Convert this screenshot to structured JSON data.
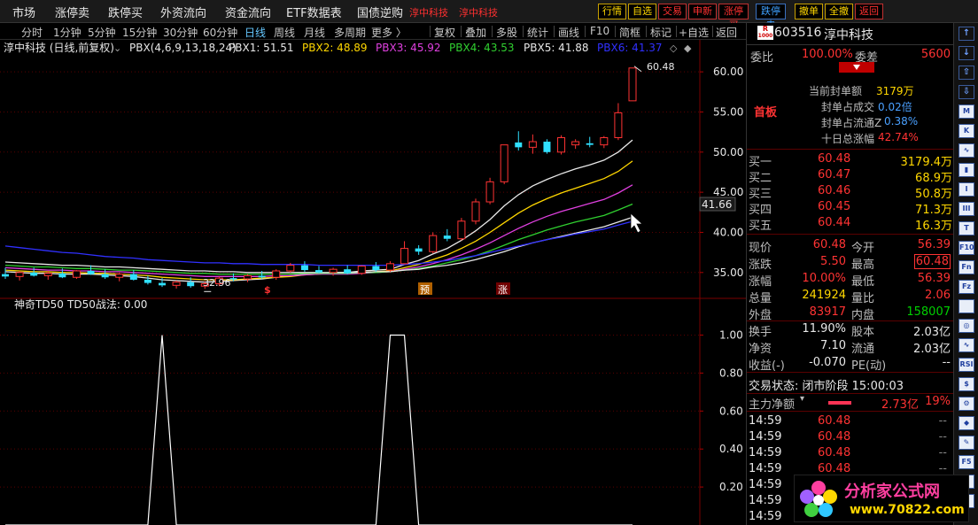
{
  "menu": {
    "items": [
      "市场",
      "涨停卖",
      "跌停买",
      "外资流向",
      "资金流向",
      "ETF数据表",
      "国债逆购"
    ],
    "red_items": [
      "淳中科技",
      "淳中科技"
    ],
    "buttons": [
      "行情",
      "自选",
      "交易",
      "申新",
      "涨停买",
      "跌停卖",
      "撤单",
      "全撤",
      "返回"
    ]
  },
  "toolbar": {
    "left": [
      "分时",
      "1分钟",
      "5分钟",
      "15分钟",
      "30分钟",
      "60分钟",
      "日线",
      "周线",
      "月线",
      "多周期",
      "更多 〉"
    ],
    "active": "日线",
    "right": [
      "复权",
      "叠加",
      "多股",
      "统计",
      "画线",
      "F10",
      "简框",
      "标记",
      "+自选",
      "返回"
    ]
  },
  "legend": {
    "title": "淳中科技 (日线,前复权)",
    "formula": "PBX(4,6,9,13,18,24)",
    "items": [
      {
        "label": "PBX1: 51.51",
        "color": "#e8e8e8"
      },
      {
        "label": "PBX2: 48.89",
        "color": "#ffd700"
      },
      {
        "label": "PBX3: 45.92",
        "color": "#e040e0"
      },
      {
        "label": "PBX4: 43.53",
        "color": "#30d030"
      },
      {
        "label": "PBX5: 41.88",
        "color": "#e8e8e8"
      },
      {
        "label": "PBX6: 41.37",
        "color": "#3030ff"
      }
    ]
  },
  "price_axis": {
    "ticks": [
      "60.00",
      "55.00",
      "50.00",
      "45.00",
      "40.00",
      "35.00"
    ],
    "current": "41.66"
  },
  "annotations": {
    "high": "60.48",
    "low": "32.96",
    "signals": [
      "$",
      "预",
      "涨"
    ]
  },
  "indicator": {
    "name": "神奇TD50",
    "value_label": "TD50战法: 0.00",
    "ticks": [
      "1.00",
      "0.80",
      "0.60",
      "0.40",
      "0.20"
    ]
  },
  "stock": {
    "code": "603516",
    "name": "淳中科技",
    "badge_top": "R",
    "badge_bottom": "1000"
  },
  "quote": {
    "weibi_label": "委比",
    "weibi": "100.00%",
    "weicha_label": "委差",
    "weicha": "5600",
    "tag": "首板",
    "seal": [
      {
        "label": "当前封单额",
        "value": "3179万",
        "color": "#ffd700"
      },
      {
        "label": "封单占成交",
        "value": "0.02倍",
        "color": "#4aa0ff"
      },
      {
        "label": "封单占流通Z",
        "value": "0.38%",
        "color": "#4aa0ff"
      },
      {
        "label": "十日总涨幅",
        "value": "42.74%",
        "color": "#ff3333"
      }
    ],
    "bids": [
      {
        "label": "买一",
        "price": "60.48",
        "vol": "3179.4万"
      },
      {
        "label": "买二",
        "price": "60.47",
        "vol": "68.9万"
      },
      {
        "label": "买三",
        "price": "60.46",
        "vol": "50.8万"
      },
      {
        "label": "买四",
        "price": "60.45",
        "vol": "71.3万"
      },
      {
        "label": "买五",
        "price": "60.44",
        "vol": "16.3万"
      }
    ],
    "stats": [
      {
        "l1": "现价",
        "v1": "60.48",
        "c1": "#ff3333",
        "l2": "今开",
        "v2": "56.39",
        "c2": "#ff3333"
      },
      {
        "l1": "涨跌",
        "v1": "5.50",
        "c1": "#ff3333",
        "l2": "最高",
        "v2": "60.48",
        "c2": "#ff3333"
      },
      {
        "l1": "涨幅",
        "v1": "10.00%",
        "c1": "#ff3333",
        "l2": "最低",
        "v2": "56.39",
        "c2": "#ff3333"
      },
      {
        "l1": "总量",
        "v1": "241924",
        "c1": "#ffd700",
        "l2": "量比",
        "v2": "2.06",
        "c2": "#ff3333"
      },
      {
        "l1": "外盘",
        "v1": "83917",
        "c1": "#ff3333",
        "l2": "内盘",
        "v2": "158007",
        "c2": "#00d000"
      },
      {
        "l1": "换手",
        "v1": "11.90%",
        "c1": "#e8e8e8",
        "l2": "股本",
        "v2": "2.03亿",
        "c2": "#e8e8e8"
      },
      {
        "l1": "净资",
        "v1": "7.10",
        "c1": "#e8e8e8",
        "l2": "流通",
        "v2": "2.03亿",
        "c2": "#e8e8e8"
      },
      {
        "l1": "收益(-)",
        "v1": "-0.070",
        "c1": "#e8e8e8",
        "l2": "PE(动)",
        "v2": "--",
        "c2": "#e8e8e8"
      }
    ],
    "trade_status": "交易状态: 闭市阶段 15:00:03",
    "main_flow_label": "主力净额",
    "main_flow_value": "2.73亿",
    "main_flow_pct": "19%",
    "ticks": [
      {
        "time": "14:59",
        "price": "60.48",
        "vol": "--"
      },
      {
        "time": "14:59",
        "price": "60.48",
        "vol": "--"
      },
      {
        "time": "14:59",
        "price": "60.48",
        "vol": "--"
      },
      {
        "time": "14:59",
        "price": "60.48",
        "vol": "--"
      },
      {
        "time": "14:59",
        "price": "60.48",
        "vol": "--"
      },
      {
        "time": "14:59",
        "price": "",
        "vol": ""
      },
      {
        "time": "14:59",
        "price": "",
        "vol": ""
      },
      {
        "time": "14:59",
        "price": "",
        "vol": ""
      }
    ]
  },
  "iconbar": [
    "↑",
    "↓",
    "⇧",
    "⇩",
    "M",
    "K",
    "∿",
    "▮",
    "I",
    "III",
    "T",
    "F10",
    "Fn",
    "Fz",
    "",
    "◎",
    "∿",
    "RSI",
    "$",
    "⚙",
    "⬥",
    "✎",
    "F5",
    "⇆",
    ""
  ],
  "watermark": {
    "brand": "分析家公式网",
    "url": "www.70822.com"
  },
  "colors": {
    "up": "#ff3333",
    "down": "#30e0ff",
    "bg": "#000000",
    "grid": "#5a0000",
    "pbx1": "#e8e8e8",
    "pbx2": "#ffd700",
    "pbx3": "#e040e0",
    "pbx4": "#30d030",
    "pbx5": "#e8e8e8",
    "pbx6": "#3030ff"
  },
  "chart_data": {
    "type": "candlestick",
    "ylim": [
      32,
      62
    ],
    "indicator_ylim": [
      0,
      1.1
    ],
    "candles": [
      {
        "o": 34.8,
        "h": 35.6,
        "l": 34.2,
        "c": 34.5
      },
      {
        "o": 34.5,
        "h": 35.2,
        "l": 34.0,
        "c": 35.0
      },
      {
        "o": 35.0,
        "h": 35.6,
        "l": 34.5,
        "c": 34.6
      },
      {
        "o": 34.6,
        "h": 35.2,
        "l": 34.1,
        "c": 34.9
      },
      {
        "o": 34.9,
        "h": 35.5,
        "l": 34.3,
        "c": 34.4
      },
      {
        "o": 34.4,
        "h": 35.3,
        "l": 34.2,
        "c": 35.2
      },
      {
        "o": 35.2,
        "h": 35.9,
        "l": 34.7,
        "c": 34.8
      },
      {
        "o": 34.8,
        "h": 35.4,
        "l": 34.2,
        "c": 34.4
      },
      {
        "o": 34.4,
        "h": 35.0,
        "l": 33.9,
        "c": 34.8
      },
      {
        "o": 34.8,
        "h": 35.3,
        "l": 34.0,
        "c": 34.1
      },
      {
        "o": 34.1,
        "h": 34.6,
        "l": 33.5,
        "c": 33.7
      },
      {
        "o": 33.7,
        "h": 34.3,
        "l": 33.2,
        "c": 33.4
      },
      {
        "o": 33.4,
        "h": 34.0,
        "l": 33.0,
        "c": 33.8
      },
      {
        "o": 33.8,
        "h": 34.4,
        "l": 33.1,
        "c": 33.3
      },
      {
        "o": 33.3,
        "h": 33.9,
        "l": 32.96,
        "c": 33.6
      },
      {
        "o": 33.6,
        "h": 34.5,
        "l": 33.3,
        "c": 34.3
      },
      {
        "o": 34.3,
        "h": 34.9,
        "l": 33.9,
        "c": 34.2
      },
      {
        "o": 34.2,
        "h": 34.8,
        "l": 33.8,
        "c": 34.6
      },
      {
        "o": 34.6,
        "h": 35.2,
        "l": 34.2,
        "c": 34.4
      },
      {
        "o": 34.4,
        "h": 35.4,
        "l": 34.1,
        "c": 35.2
      },
      {
        "o": 35.2,
        "h": 36.2,
        "l": 35.0,
        "c": 35.9
      },
      {
        "o": 35.9,
        "h": 36.4,
        "l": 35.1,
        "c": 35.3
      },
      {
        "o": 35.3,
        "h": 35.8,
        "l": 34.9,
        "c": 35.0
      },
      {
        "o": 35.0,
        "h": 35.6,
        "l": 34.6,
        "c": 35.4
      },
      {
        "o": 35.4,
        "h": 35.9,
        "l": 34.8,
        "c": 34.9
      },
      {
        "o": 34.9,
        "h": 35.9,
        "l": 34.7,
        "c": 35.8
      },
      {
        "o": 35.8,
        "h": 36.3,
        "l": 35.1,
        "c": 35.3
      },
      {
        "o": 35.3,
        "h": 36.4,
        "l": 35.1,
        "c": 36.1
      },
      {
        "o": 36.1,
        "h": 38.9,
        "l": 36.0,
        "c": 38.0
      },
      {
        "o": 38.0,
        "h": 38.4,
        "l": 37.2,
        "c": 37.6
      },
      {
        "o": 37.6,
        "h": 40.0,
        "l": 37.4,
        "c": 39.6
      },
      {
        "o": 39.6,
        "h": 40.4,
        "l": 38.9,
        "c": 39.2
      },
      {
        "o": 39.2,
        "h": 41.8,
        "l": 39.0,
        "c": 41.4
      },
      {
        "o": 41.4,
        "h": 44.2,
        "l": 41.0,
        "c": 43.8
      },
      {
        "o": 43.8,
        "h": 46.8,
        "l": 43.5,
        "c": 46.3
      },
      {
        "o": 46.3,
        "h": 50.9,
        "l": 46.0,
        "c": 50.9
      },
      {
        "o": 51.2,
        "h": 52.6,
        "l": 50.2,
        "c": 50.6
      },
      {
        "o": 50.6,
        "h": 52.2,
        "l": 49.8,
        "c": 51.3
      },
      {
        "o": 51.3,
        "h": 51.6,
        "l": 49.8,
        "c": 50.0
      },
      {
        "o": 50.0,
        "h": 52.1,
        "l": 49.7,
        "c": 51.8
      },
      {
        "o": 50.9,
        "h": 51.6,
        "l": 50.4,
        "c": 51.3
      },
      {
        "o": 51.1,
        "h": 51.9,
        "l": 50.6,
        "c": 50.9
      },
      {
        "o": 50.9,
        "h": 52.0,
        "l": 50.5,
        "c": 51.8
      },
      {
        "o": 51.8,
        "h": 56.1,
        "l": 51.5,
        "c": 54.9
      },
      {
        "o": 56.39,
        "h": 60.48,
        "l": 56.39,
        "c": 60.48
      }
    ],
    "series": [
      {
        "name": "PBX1",
        "color": "#e8e8e8",
        "y": [
          35.1,
          35.0,
          34.9,
          34.9,
          34.8,
          34.8,
          34.8,
          34.7,
          34.6,
          34.5,
          34.3,
          34.1,
          34.0,
          33.9,
          33.8,
          33.9,
          34.0,
          34.1,
          34.2,
          34.4,
          34.6,
          34.8,
          34.9,
          35.0,
          35.0,
          35.2,
          35.3,
          35.4,
          36.0,
          36.5,
          37.3,
          38.0,
          39.0,
          40.2,
          41.6,
          43.3,
          44.7,
          45.8,
          46.6,
          47.3,
          47.9,
          48.4,
          49.0,
          50.0,
          51.51
        ]
      },
      {
        "name": "PBX2",
        "color": "#ffd700",
        "y": [
          35.3,
          35.2,
          35.1,
          35.1,
          35.0,
          35.0,
          34.9,
          34.9,
          34.8,
          34.7,
          34.6,
          34.4,
          34.3,
          34.2,
          34.1,
          34.1,
          34.1,
          34.2,
          34.3,
          34.4,
          34.5,
          34.7,
          34.8,
          34.9,
          34.9,
          35.0,
          35.1,
          35.2,
          35.6,
          36.0,
          36.6,
          37.2,
          38.0,
          38.9,
          40.0,
          41.2,
          42.4,
          43.4,
          44.2,
          44.9,
          45.5,
          46.1,
          46.7,
          47.6,
          48.89
        ]
      },
      {
        "name": "PBX3",
        "color": "#e040e0",
        "y": [
          35.6,
          35.5,
          35.4,
          35.3,
          35.3,
          35.2,
          35.2,
          35.1,
          35.1,
          35.0,
          34.9,
          34.8,
          34.7,
          34.6,
          34.5,
          34.5,
          34.5,
          34.5,
          34.5,
          34.6,
          34.6,
          34.7,
          34.8,
          34.8,
          34.8,
          34.9,
          35.0,
          35.1,
          35.4,
          35.7,
          36.1,
          36.6,
          37.2,
          37.9,
          38.7,
          39.6,
          40.5,
          41.3,
          42.0,
          42.6,
          43.1,
          43.6,
          44.1,
          44.9,
          45.92
        ]
      },
      {
        "name": "PBX4",
        "color": "#30d030",
        "y": [
          35.9,
          35.8,
          35.7,
          35.7,
          35.6,
          35.5,
          35.5,
          35.4,
          35.3,
          35.3,
          35.2,
          35.1,
          35.0,
          34.9,
          34.9,
          34.8,
          34.8,
          34.8,
          34.8,
          34.8,
          34.8,
          34.9,
          34.9,
          34.9,
          34.9,
          35.0,
          35.0,
          35.1,
          35.3,
          35.5,
          35.8,
          36.2,
          36.6,
          37.1,
          37.7,
          38.4,
          39.1,
          39.7,
          40.3,
          40.8,
          41.3,
          41.7,
          42.1,
          42.8,
          43.53
        ]
      },
      {
        "name": "PBX5",
        "color": "#e8e8e8",
        "y": [
          36.3,
          36.2,
          36.1,
          36.0,
          35.9,
          35.9,
          35.8,
          35.7,
          35.7,
          35.6,
          35.5,
          35.4,
          35.3,
          35.2,
          35.2,
          35.1,
          35.1,
          35.0,
          35.0,
          35.0,
          35.0,
          35.0,
          35.0,
          35.0,
          35.0,
          35.0,
          35.1,
          35.1,
          35.3,
          35.4,
          35.7,
          35.9,
          36.2,
          36.6,
          37.1,
          37.6,
          38.2,
          38.7,
          39.1,
          39.5,
          39.9,
          40.3,
          40.7,
          41.3,
          41.88
        ]
      },
      {
        "name": "PBX6",
        "color": "#3030ff",
        "y": [
          38.3,
          38.1,
          37.9,
          37.7,
          37.5,
          37.4,
          37.2,
          37.0,
          36.9,
          36.8,
          36.6,
          36.5,
          36.4,
          36.3,
          36.2,
          36.2,
          36.1,
          36.1,
          36.0,
          36.0,
          36.0,
          36.0,
          35.9,
          35.9,
          35.9,
          35.9,
          35.9,
          35.9,
          36.0,
          36.1,
          36.3,
          36.5,
          36.8,
          37.1,
          37.5,
          37.9,
          38.3,
          38.7,
          39.1,
          39.4,
          39.8,
          40.1,
          40.4,
          40.9,
          41.37
        ]
      }
    ],
    "td50": [
      0,
      0,
      0,
      0,
      0,
      0,
      0,
      0,
      0,
      0,
      0,
      1,
      0,
      0,
      0,
      0,
      0,
      0,
      0,
      0,
      0,
      0,
      0,
      0,
      0,
      0,
      0,
      1,
      1,
      0,
      0,
      0,
      0,
      0,
      0,
      0,
      0,
      0,
      0,
      0,
      0,
      0,
      0,
      0,
      0
    ]
  }
}
